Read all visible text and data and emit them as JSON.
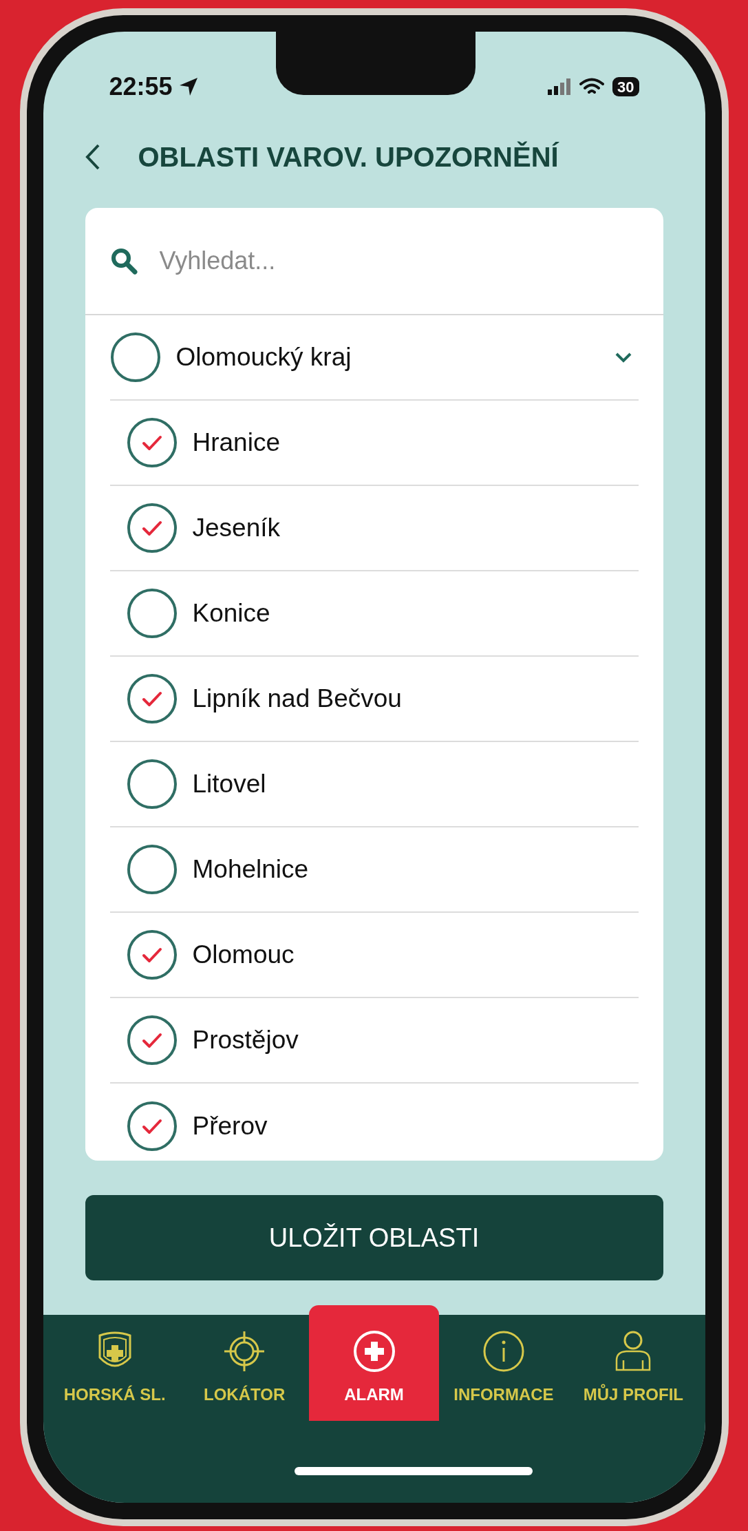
{
  "status_bar": {
    "time": "22:55",
    "battery": "30"
  },
  "header": {
    "title": "OBLASTI VAROV. UPOZORNĚNÍ"
  },
  "search": {
    "placeholder": "Vyhledat..."
  },
  "region": {
    "name": "Olomoucký kraj",
    "checked": false,
    "expanded": true,
    "children": [
      {
        "name": "Hranice",
        "checked": true
      },
      {
        "name": "Jeseník",
        "checked": true
      },
      {
        "name": "Konice",
        "checked": false
      },
      {
        "name": "Lipník nad Bečvou",
        "checked": true
      },
      {
        "name": "Litovel",
        "checked": false
      },
      {
        "name": "Mohelnice",
        "checked": false
      },
      {
        "name": "Olomouc",
        "checked": true
      },
      {
        "name": "Prostějov",
        "checked": true
      },
      {
        "name": "Přerov",
        "checked": true
      }
    ]
  },
  "save_button": "ULOŽIT OBLASTI",
  "nav": [
    {
      "label": "HORSKÁ SL.",
      "kind": "badge",
      "selected": false
    },
    {
      "label": "LOKÁTOR",
      "kind": "target",
      "selected": false
    },
    {
      "label": "ALARM",
      "kind": "alarm",
      "selected": true
    },
    {
      "label": "INFORMACE",
      "kind": "info",
      "selected": false
    },
    {
      "label": "MŮJ PROFIL",
      "kind": "profile",
      "selected": false
    }
  ]
}
